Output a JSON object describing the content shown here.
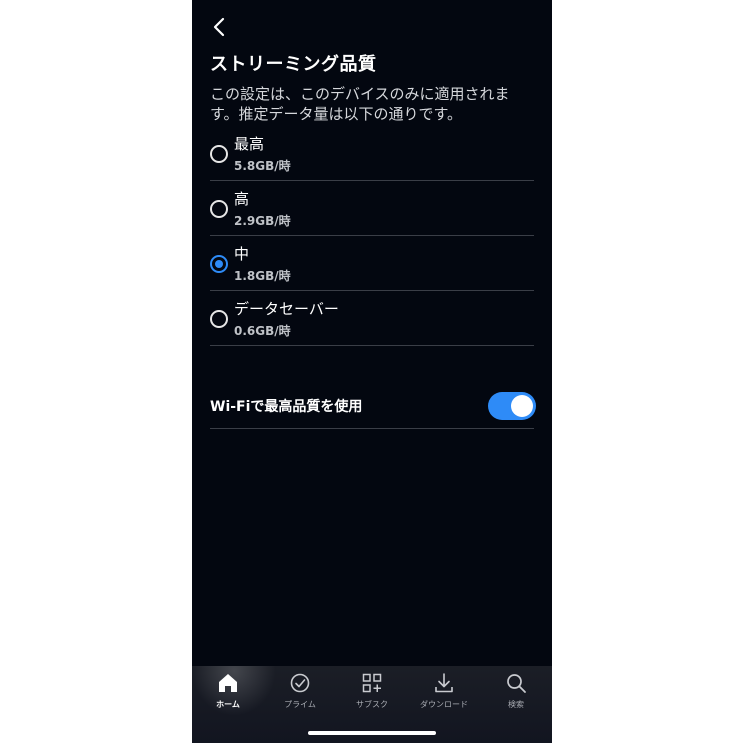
{
  "header": {
    "back_icon": "chevron-left-icon",
    "title": "ストリーミング品質",
    "description": "この設定は、このデバイスのみに適用されます。推定データ量は以下の通りです。"
  },
  "options": [
    {
      "label": "最高",
      "sub": "5.8GB/時",
      "selected": false
    },
    {
      "label": "高",
      "sub": "2.9GB/時",
      "selected": false
    },
    {
      "label": "中",
      "sub": "1.8GB/時",
      "selected": true
    },
    {
      "label": "データセーバー",
      "sub": "0.6GB/時",
      "selected": false
    }
  ],
  "wifi": {
    "label": "Wi-Fiで最高品質を使用",
    "enabled": true
  },
  "tabs": [
    {
      "label": "ホーム",
      "icon": "home-icon",
      "active": true
    },
    {
      "label": "プライム",
      "icon": "check-circle-icon",
      "active": false
    },
    {
      "label": "サブスク",
      "icon": "grid-plus-icon",
      "active": false
    },
    {
      "label": "ダウンロード",
      "icon": "download-icon",
      "active": false
    },
    {
      "label": "検索",
      "icon": "search-icon",
      "active": false
    }
  ],
  "colors": {
    "background": "#030710",
    "accent": "#2e8bf7",
    "divider": "#3a3e47"
  }
}
